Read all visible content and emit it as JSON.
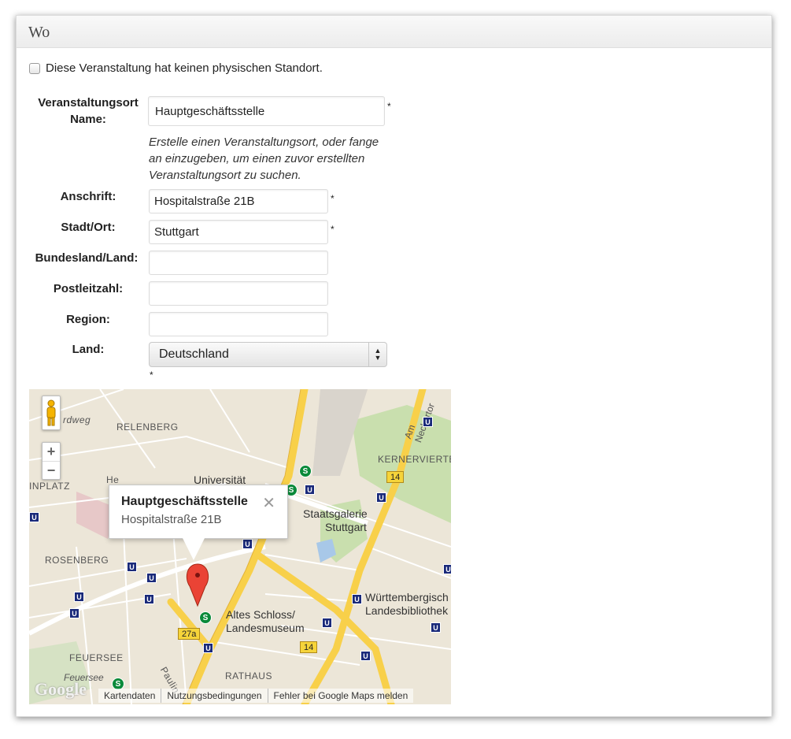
{
  "panel": {
    "title": "Wo",
    "no_physical_location_label": "Diese Veranstaltung hat keinen physischen Standort."
  },
  "form": {
    "venue_label_line1": "Veranstaltungsort",
    "venue_label_line2": "Name:",
    "venue_value": "Hauptgeschäftsstelle",
    "venue_hint": "Erstelle einen Veranstaltungsort, oder fange an einzugeben, um einen zuvor erstellten Veranstaltungsort zu suchen.",
    "address_label": "Anschrift:",
    "address_value": "Hospitalstraße 21B",
    "city_label": "Stadt/Ort:",
    "city_value": "Stuttgart",
    "state_label": "Bundesland/Land:",
    "state_value": "",
    "zip_label": "Postleitzahl:",
    "zip_value": "",
    "region_label": "Region:",
    "region_value": "",
    "country_label": "Land:",
    "country_value": "Deutschland",
    "required_mark": "*"
  },
  "map": {
    "infowindow_title": "Hauptgeschäftsstelle",
    "infowindow_address": "Hospitalstraße 21B",
    "google_logo": "Google",
    "footer_links": [
      "Kartendaten",
      "Nutzungsbedingungen",
      "Fehler bei Google Maps melden"
    ],
    "place_labels": {
      "relenberg": "RELENBERG",
      "universitaet": "Universität",
      "kernerviertel": "KERNERVIERTEL",
      "staatsgalerie_1": "Staatsgalerie",
      "staatsgalerie_2": "Stuttgart",
      "rosenberg": "ROSENBERG",
      "wuerttemberg_1": "Württembergisch",
      "wuerttemberg_2": "Landesbibliothek",
      "altes_schloss_1": "Altes Schloss/",
      "altes_schloss_2": "Landesmuseum",
      "feuersee": "FEUERSEE",
      "feuersee_small": "Feuersee",
      "rathaus": "RATHAUS",
      "inplatz": "INPLATZ",
      "rdweg": "rdweg",
      "am_neckartor": "Am Neckartor",
      "paulinen": "Paulin",
      "he": "He"
    },
    "route_badges": [
      "14",
      "14",
      "27a"
    ]
  }
}
